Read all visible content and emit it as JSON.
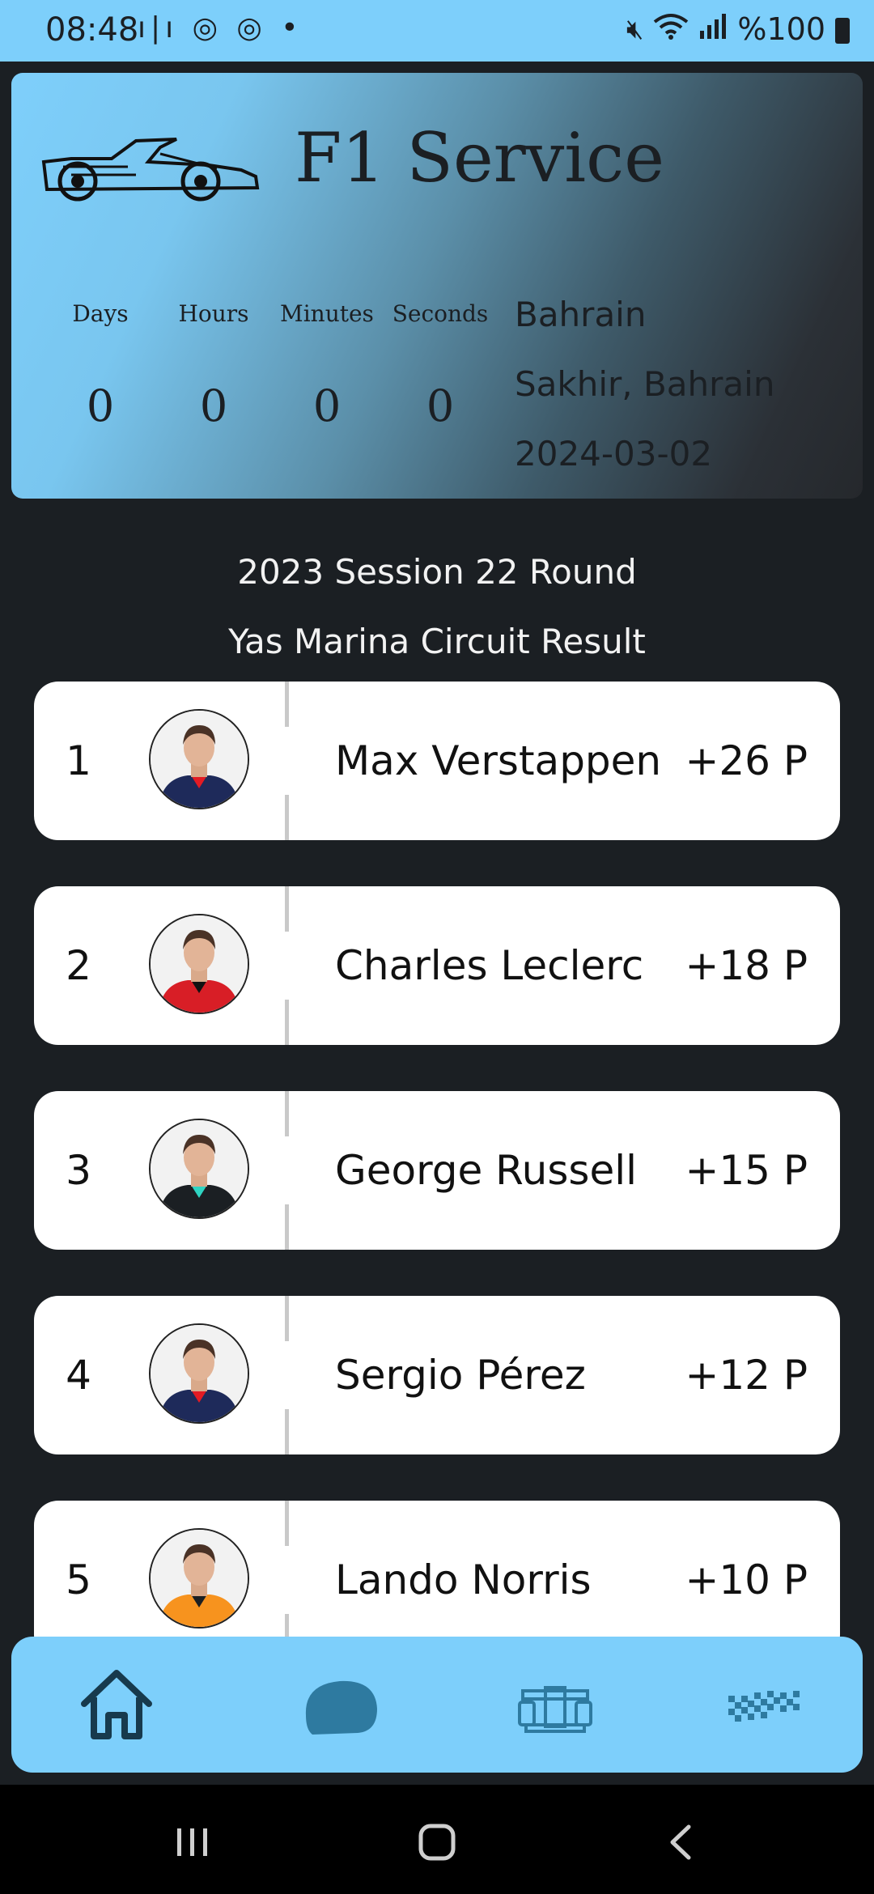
{
  "status_bar": {
    "time": "08:48",
    "left_icons": "ı|ı ◎ ◎ •",
    "battery_text": "%100"
  },
  "header": {
    "title": "F1 Service",
    "countdown": [
      {
        "label": "Days",
        "value": "0"
      },
      {
        "label": "Hours",
        "value": "0"
      },
      {
        "label": "Minutes",
        "value": "0"
      },
      {
        "label": "Seconds",
        "value": "0"
      }
    ],
    "race": {
      "name": "Bahrain",
      "location": "Sakhir, Bahrain",
      "date": "2024-03-02"
    }
  },
  "results": {
    "title_line1": "2023 Session 22 Round",
    "title_line2": "Yas Marina Circuit Result",
    "rows": [
      {
        "position": "1",
        "name": "Max Verstappen",
        "points": "+26 P",
        "suit_color": "#1e2a5a",
        "accent": "#e31b23"
      },
      {
        "position": "2",
        "name": "Charles Leclerc",
        "points": "+18 P",
        "suit_color": "#d81e26",
        "accent": "#111111"
      },
      {
        "position": "3",
        "name": "George Russell",
        "points": "+15 P",
        "suit_color": "#1b1f23",
        "accent": "#2fd4c2"
      },
      {
        "position": "4",
        "name": "Sergio Pérez",
        "points": "+12 P",
        "suit_color": "#1e2a5a",
        "accent": "#e31b23"
      },
      {
        "position": "5",
        "name": "Lando Norris",
        "points": "+10 P",
        "suit_color": "#f7931e",
        "accent": "#1b1f23"
      }
    ]
  },
  "bottom_nav": {
    "items": [
      {
        "icon": "home-icon"
      },
      {
        "icon": "helmet-icon"
      },
      {
        "icon": "race-car-icon"
      },
      {
        "icon": "checkered-flag-icon"
      }
    ]
  },
  "colors": {
    "accent": "#7dcffb",
    "background": "#1b1f23",
    "nav_icon": "#2e7aa0"
  }
}
